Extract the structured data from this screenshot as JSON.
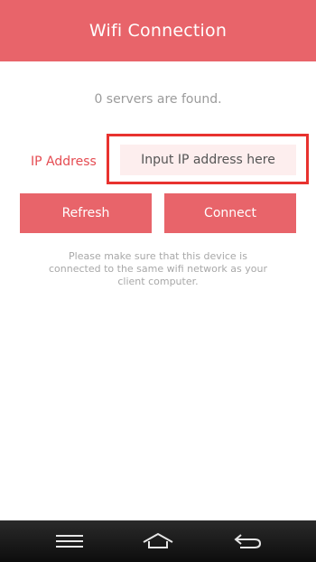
{
  "header": {
    "title": "Wifi Connection"
  },
  "status": {
    "text": "0 servers are found."
  },
  "form": {
    "ip_label": "IP Address",
    "ip_placeholder": "Input IP address here",
    "ip_value": ""
  },
  "buttons": {
    "refresh": "Refresh",
    "connect": "Connect"
  },
  "hint": {
    "text": "Please make sure that this device is connected to the same wifi network as your client computer."
  },
  "navbar": {
    "icons": [
      "menu-icon",
      "home-icon",
      "back-icon"
    ]
  },
  "colors": {
    "accent": "#e8646a",
    "label": "#e54c52",
    "input_bg": "#fdeeee",
    "highlight": "#e8322f"
  }
}
